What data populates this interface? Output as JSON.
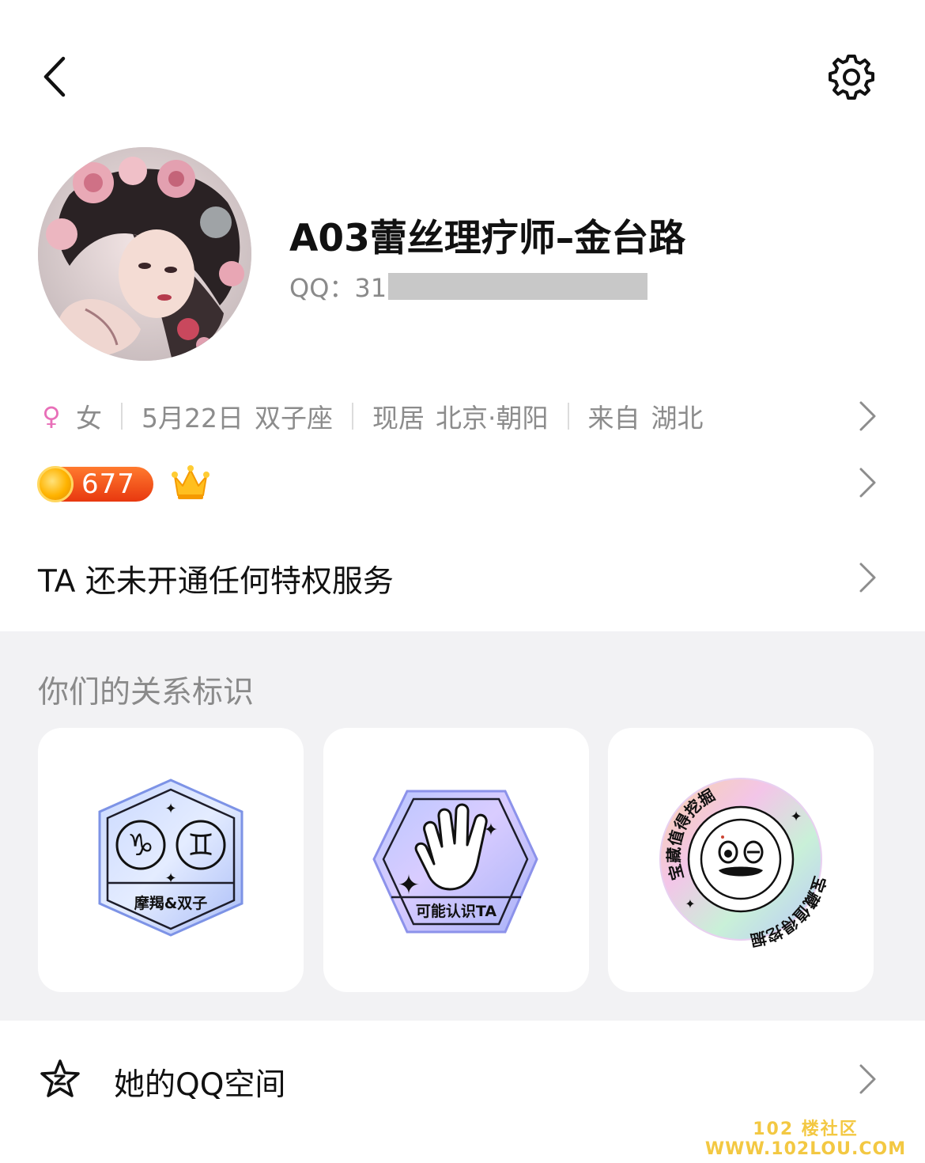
{
  "header": {
    "back_icon": "chevron-left-icon",
    "settings_icon": "gear-icon"
  },
  "profile": {
    "nickname": "A03蕾丝理疗师–金台路",
    "qq_label": "QQ：31"
  },
  "info": {
    "gender_symbol": "♀",
    "gender": "女",
    "birthday": "5月22日",
    "zodiac": "双子座",
    "residence_label": "现居",
    "residence": "北京·朝阳",
    "hometown_label": "来自",
    "hometown": "湖北"
  },
  "level": {
    "value": "677",
    "coin_color": "#ffb300",
    "badge_color": "#e8380f"
  },
  "privilege": {
    "text": "TA 还未开通任何特权服务"
  },
  "relationship": {
    "title": "你们的关系标识",
    "badges": [
      {
        "label": "摩羯&双子",
        "icon": "capricorn-gemini-icon"
      },
      {
        "label": "可能认识TA",
        "icon": "waving-hand-icon"
      },
      {
        "label_top": "宝藏值得挖掘",
        "label_bottom": "宝藏值得挖掘",
        "icon": "treasure-face-icon"
      }
    ]
  },
  "qzone": {
    "label": "她的QQ空间",
    "icon": "qzone-star-icon"
  },
  "watermark": {
    "line1": "102 楼社区",
    "line2": "WWW.102LOU.COM"
  }
}
